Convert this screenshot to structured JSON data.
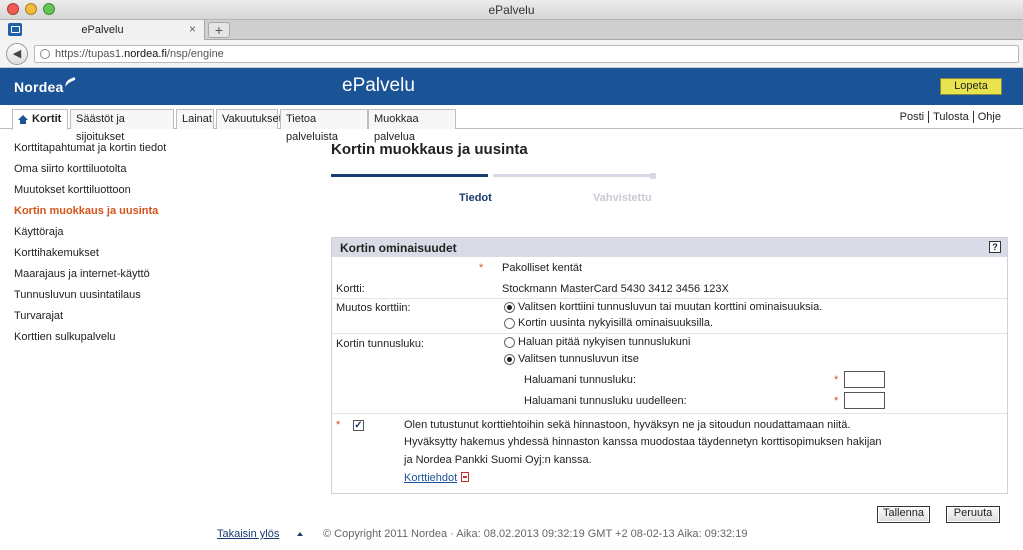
{
  "browser": {
    "window_title": "ePalvelu",
    "tab_title": "ePalvelu",
    "tab_close": "×",
    "new_tab": "+",
    "back_glyph": "◀",
    "url_prefix": "https://tupas1.",
    "url_domain": "nordea.fi",
    "url_suffix": "/nsp/engine"
  },
  "header": {
    "logo": "Nordea",
    "app_title": "ePalvelu",
    "logout_label": "Lopeta"
  },
  "menu": {
    "tabs": [
      {
        "label": "Kortit"
      },
      {
        "label": "Säästöt ja sijoitukset"
      },
      {
        "label": "Lainat"
      },
      {
        "label": "Vakuutukset"
      },
      {
        "label": "Tietoa palveluista"
      },
      {
        "label": "Muokkaa palvelua"
      }
    ],
    "right_links": [
      {
        "label": "Posti"
      },
      {
        "label": "Tulosta"
      },
      {
        "label": "Ohje"
      }
    ]
  },
  "sidebar": {
    "items": [
      {
        "label": "Korttitapahtumat ja kortin tiedot"
      },
      {
        "label": "Oma siirto korttiluotolta"
      },
      {
        "label": "Muutokset korttiluottoon"
      },
      {
        "label": "Kortin muokkaus ja uusinta"
      },
      {
        "label": "Käyttöraja"
      },
      {
        "label": "Korttihakemukset"
      },
      {
        "label": "Maarajaus ja internet-käyttö"
      },
      {
        "label": "Tunnusluvun uusintatilaus"
      },
      {
        "label": "Turvarajat"
      },
      {
        "label": "Korttien sulkupalvelu"
      }
    ]
  },
  "main": {
    "title": "Kortin muokkaus ja uusinta",
    "steps": [
      {
        "label": "Tiedot"
      },
      {
        "label": "Vahvistettu"
      }
    ],
    "panel": {
      "title": "Kortin ominaisuudet",
      "help_glyph": "?",
      "required_star": "*",
      "required_note": "Pakolliset kentät",
      "card_label": "Kortti:",
      "card_value": "Stockmann MasterCard   5430 3412 3456 123X",
      "change_label": "Muutos korttiin:",
      "change_options": [
        {
          "label": "Valitsen korttiini tunnusluvun tai muutan korttini ominaisuuksia.",
          "selected": true
        },
        {
          "label": "Kortin uusinta nykyisillä ominaisuuksilla.",
          "selected": false
        }
      ],
      "pin_label": "Kortin tunnusluku:",
      "pin_options": [
        {
          "label": "Haluan pitää nykyisen tunnuslukuni",
          "selected": false
        },
        {
          "label": "Valitsen tunnusluvun itse",
          "selected": true
        }
      ],
      "pin_field_label": "Haluamani tunnusluku:",
      "pin_field_value": "",
      "pin_repeat_label": "Haluamani tunnusluku uudelleen:",
      "pin_repeat_value": "",
      "terms_checked": true,
      "terms_check_glyph": "✓",
      "terms_lines": [
        "Olen tutustunut korttiehtoihin sekä hinnastoon, hyväksyn ne ja sitoudun noudattamaan niitä.",
        "Hyväksytty hakemus yhdessä hinnaston kanssa muodostaa täydennetyn korttisopimuksen hakijan",
        "ja Nordea Pankki Suomi Oyj:n  kanssa."
      ],
      "terms_link": "Korttiehdot"
    },
    "save_label": "Tallenna",
    "cancel_label": "Peruuta"
  },
  "footer": {
    "back_to_top": "Takaisin ylös",
    "copyright": "© Copyright 2011 Nordea · Aika: 08.02.2013 09:32:19 GMT +2 08-02-13 Aika: 09:32:19"
  },
  "colors": {
    "brand_blue": "#1b5496",
    "active_orange": "#d4541a",
    "logout_yellow": "#e8e44f"
  }
}
